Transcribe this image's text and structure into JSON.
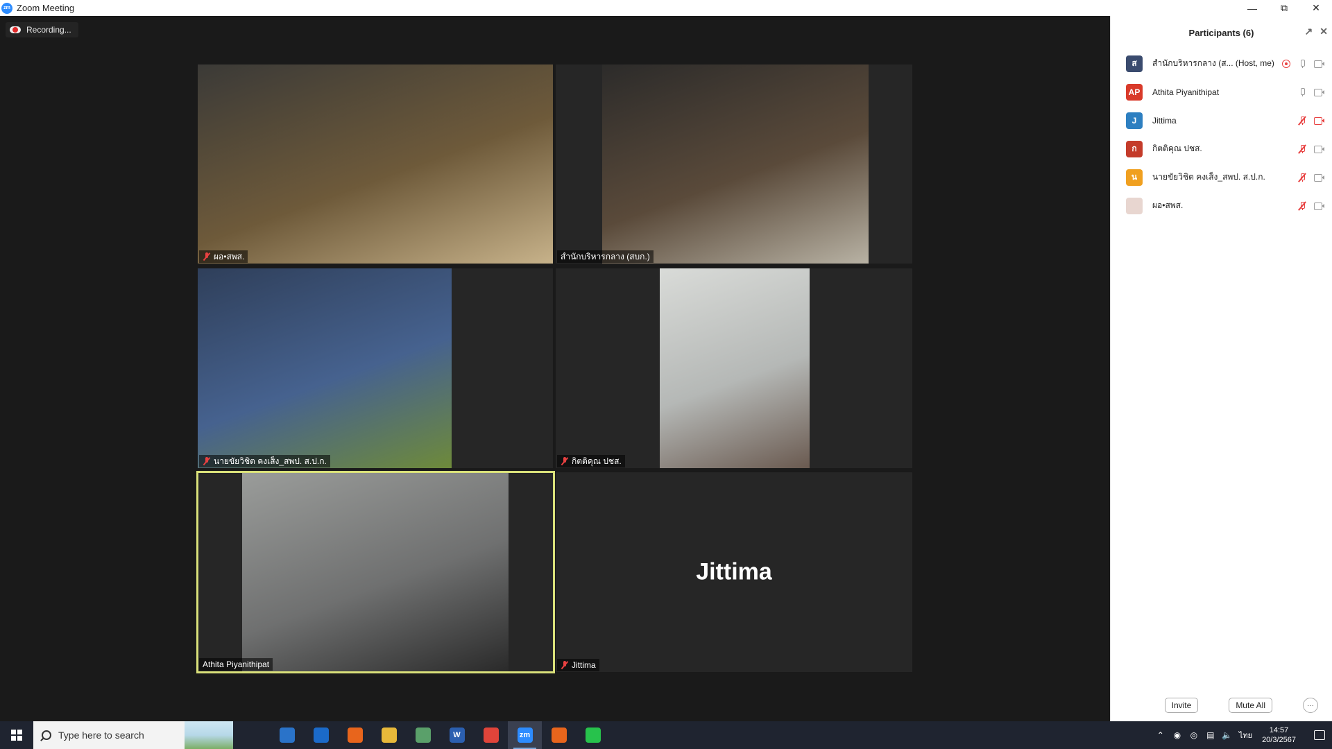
{
  "window": {
    "title": "Zoom Meeting",
    "logo_text": "zm"
  },
  "meeting": {
    "recording_label": "Recording...",
    "tiles": [
      {
        "name": "ผอ•สพส.",
        "muted": true,
        "type": "video",
        "colors": [
          "#3b3a37",
          "#6e5a3a",
          "#c7b28a"
        ]
      },
      {
        "name": "สำนักบริหารกลาง (สบก.)",
        "muted": false,
        "type": "video",
        "colors": [
          "#2c2b2a",
          "#5a4a3a",
          "#b8b2a4"
        ]
      },
      {
        "name": "นายขัยวิชิต คงเส็ง_สพป. ส.ป.ก.",
        "muted": true,
        "type": "video",
        "colors": [
          "#2f3f5a",
          "#46628f",
          "#6e8a3a"
        ]
      },
      {
        "name": "กิตติคุณ ปชส.",
        "muted": true,
        "type": "video",
        "colors": [
          "#d9dbd8",
          "#b5b8b6",
          "#6a5a50"
        ]
      },
      {
        "name": "Athita Piyanithipat",
        "muted": false,
        "type": "video",
        "active": true,
        "colors": [
          "#9a9c9a",
          "#6f7070",
          "#2a2a2a"
        ]
      },
      {
        "name": "Jittima",
        "muted": true,
        "type": "name-only",
        "display_name": "Jittima"
      }
    ]
  },
  "participants": {
    "title": "Participants (6)",
    "list": [
      {
        "initial": "ส",
        "name": "สำนักบริหารกลาง (ส... (Host, me)",
        "color": "#3a4b6e",
        "recording": true,
        "mic_muted": false,
        "cam_off": false
      },
      {
        "initial": "AP",
        "name": "Athita Piyanithipat",
        "color": "#d93a2a",
        "recording": false,
        "mic_muted": false,
        "cam_off": false
      },
      {
        "initial": "J",
        "name": "Jittima",
        "color": "#2d7fc1",
        "recording": false,
        "mic_muted": true,
        "cam_off": true
      },
      {
        "initial": "ก",
        "name": "กิตติคุณ ปชส.",
        "color": "#c43b2a",
        "recording": false,
        "mic_muted": true,
        "cam_off": false
      },
      {
        "initial": "น",
        "name": "นายขัยวิชิต คงเส็ง_สพป. ส.ป.ก.",
        "color": "#f0a020",
        "recording": false,
        "mic_muted": true,
        "cam_off": false
      },
      {
        "initial": "",
        "name": "ผอ•สพส.",
        "color": "#e8d6d0",
        "recording": false,
        "mic_muted": true,
        "cam_off": false
      }
    ],
    "invite_label": "Invite",
    "mute_all_label": "Mute All",
    "more_label": "···"
  },
  "taskbar": {
    "search_placeholder": "Type here to search",
    "apps": [
      {
        "icon": "task-view-icon",
        "label": "",
        "color": "#1f2430"
      },
      {
        "icon": "store-icon",
        "label": "",
        "color": "#2a73c9"
      },
      {
        "icon": "mail-icon",
        "label": "",
        "color": "#1b6ac9"
      },
      {
        "icon": "paint-icon",
        "label": "",
        "color": "#e8651c"
      },
      {
        "icon": "folder-icon",
        "label": "",
        "color": "#e8b93a"
      },
      {
        "icon": "green-app-icon",
        "label": "",
        "color": "#5aa06a"
      },
      {
        "icon": "word-icon",
        "label": "W",
        "color": "#2b5fb0"
      },
      {
        "icon": "chrome-icon",
        "label": "",
        "color": "#e0443a"
      },
      {
        "icon": "zoom-icon",
        "label": "zm",
        "color": "#2d8cff",
        "active": true
      },
      {
        "icon": "powerpoint-icon",
        "label": "",
        "color": "#e8651c"
      },
      {
        "icon": "line-icon",
        "label": "",
        "color": "#27c24c"
      }
    ],
    "language": "ไทย",
    "time": "14:57",
    "date": "20/3/2567"
  }
}
